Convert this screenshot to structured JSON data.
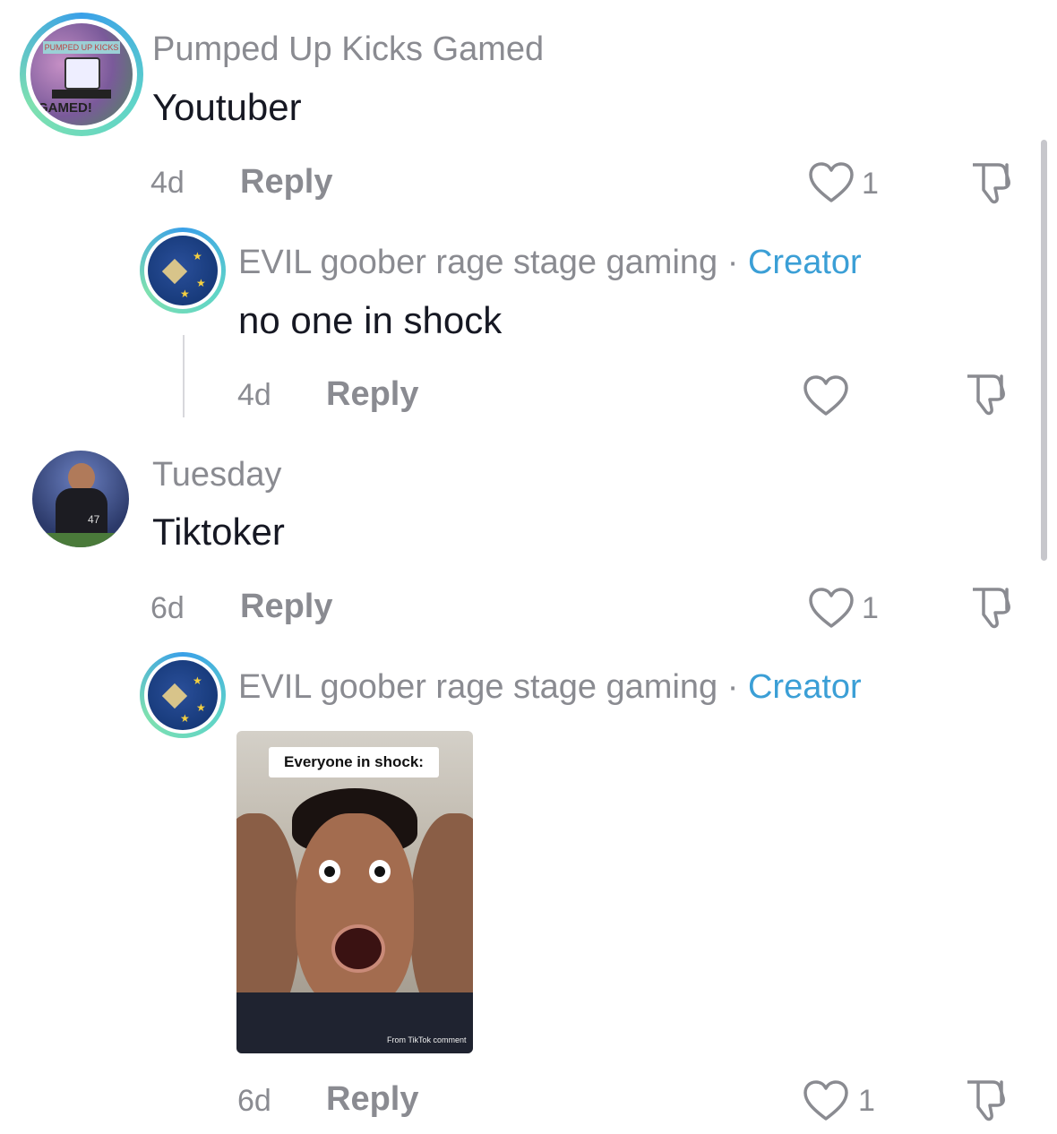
{
  "comments": [
    {
      "username": "Pumped Up Kicks Gamed",
      "text": "Youtuber",
      "time": "4d",
      "reply_label": "Reply",
      "likes": "1",
      "avatar_text_top": "PUMPED UP KICKS",
      "avatar_text_bottom": "GAMED!"
    },
    {
      "username": "EVIL goober rage stage gaming",
      "separator": "·",
      "badge": "Creator",
      "text": "no one in shock",
      "time": "4d",
      "reply_label": "Reply",
      "likes": ""
    },
    {
      "username": "Tuesday",
      "text": "Tiktoker",
      "time": "6d",
      "reply_label": "Reply",
      "likes": "1",
      "avatar_jersey_number": "47"
    },
    {
      "username": "EVIL goober rage stage gaming",
      "separator": "·",
      "badge": "Creator",
      "media_caption": "Everyone in shock:",
      "media_watermark": "From TikTok comment",
      "time": "6d",
      "reply_label": "Reply",
      "likes": "1"
    }
  ],
  "icons": {
    "like": "heart-outline-icon",
    "dislike": "thumbs-down-icon"
  },
  "colors": {
    "creator_badge": "#3b9fd6",
    "secondary_text": "#8a8b91",
    "primary_text": "#161823"
  }
}
